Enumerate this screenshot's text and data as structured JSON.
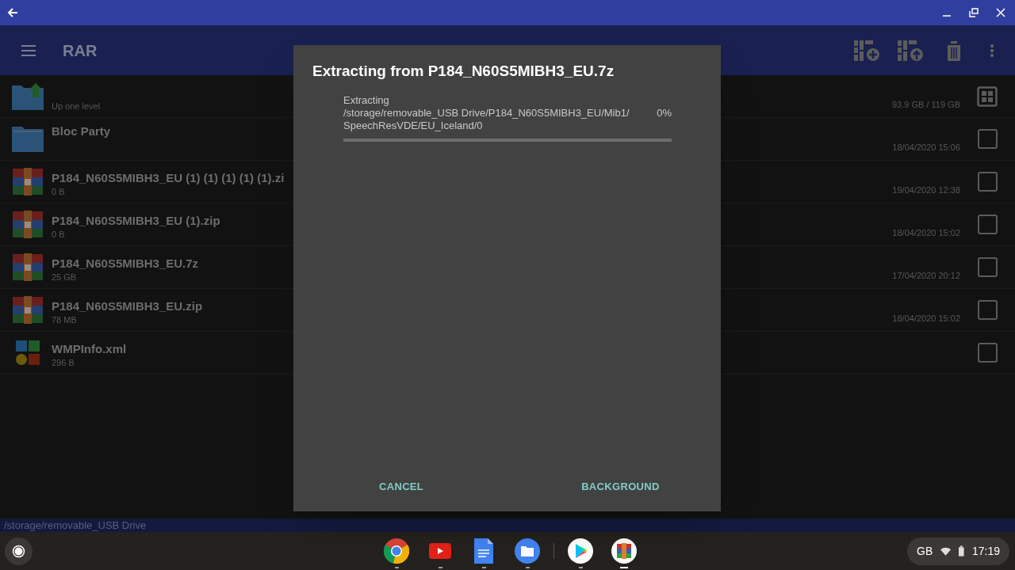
{
  "app_bar": {
    "title": "RAR"
  },
  "rows": [
    {
      "kind": "up",
      "name": "",
      "subtitle": "Up one level",
      "detail": "93.9 GB / 119 GB"
    },
    {
      "kind": "folder",
      "name": "Bloc Party",
      "detail": "18/04/2020 15:06",
      "checked": false
    },
    {
      "kind": "archive",
      "name": "P184_N60S5MIBH3_EU (1) (1) (1) (1) (1).zi",
      "subtitle": "0 B",
      "detail": "19/04/2020 12:38",
      "checked": false
    },
    {
      "kind": "archive",
      "name": "P184_N60S5MIBH3_EU (1).zip",
      "subtitle": "0 B",
      "detail": "18/04/2020 15:02",
      "checked": false
    },
    {
      "kind": "archive",
      "name": "P184_N60S5MIBH3_EU.7z",
      "subtitle": "25 GB",
      "detail": "17/04/2020 20:12",
      "checked": false
    },
    {
      "kind": "archive",
      "name": "P184_N60S5MIBH3_EU.zip",
      "subtitle": "78 MB",
      "detail": "18/04/2020 15:02",
      "checked": false
    },
    {
      "kind": "xml",
      "name": "WMPInfo.xml",
      "subtitle": "296 B",
      "checked": false
    }
  ],
  "path_bar": "/storage/removable_USB Drive",
  "dialog": {
    "title": "Extracting from P184_N60S5MIBH3_EU.7z",
    "label": "Extracting",
    "path": "/storage/removable_USB Drive/P184_N60S5MIBH3_EU/Mib1/\nSpeechResVDE/EU_Iceland/0",
    "percent": "0%",
    "level": 0,
    "buttons": [
      "CANCEL",
      "BACKGROUND"
    ]
  },
  "shelf": {
    "apps": [
      {
        "kind": "chrome",
        "active": false
      },
      {
        "kind": "youtube",
        "active": false
      },
      {
        "kind": "docs",
        "active": false
      },
      {
        "kind": "files",
        "active": false
      },
      {
        "kind": "play",
        "active": false
      },
      {
        "kind": "rar",
        "active": true
      }
    ],
    "tray": {
      "keyboard": "GB",
      "time": "17:19"
    }
  }
}
